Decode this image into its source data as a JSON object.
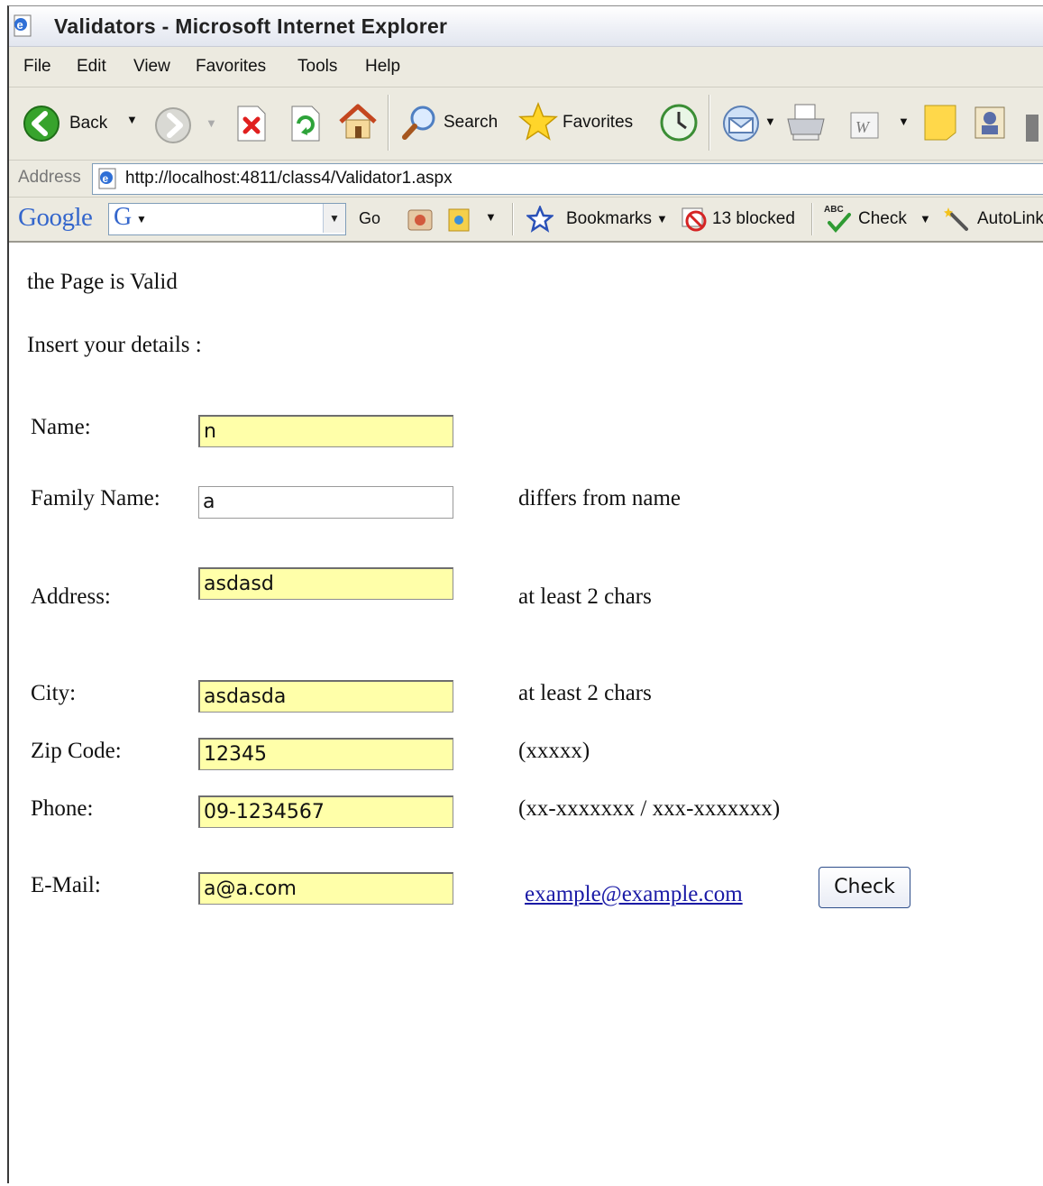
{
  "window": {
    "title": "Validators - Microsoft Internet Explorer"
  },
  "menu": [
    "File",
    "Edit",
    "View",
    "Favorites",
    "Tools",
    "Help"
  ],
  "toolbar": {
    "back_label": "Back",
    "search_label": "Search",
    "favorites_label": "Favorites"
  },
  "address": {
    "label": "Address",
    "url": "http://localhost:4811/class4/Validator1.aspx"
  },
  "googlebar": {
    "logo": "Google",
    "g_label": "G",
    "go_label": "Go",
    "bookmarks_label": "Bookmarks",
    "blocked_label": "13 blocked",
    "check_label": "Check",
    "autolink_label": "AutoLink",
    "abc_label": "ABC"
  },
  "page": {
    "status": "the Page is Valid",
    "intro": "Insert your details :",
    "fields": {
      "name": {
        "label": "Name:",
        "value": "n"
      },
      "family": {
        "label": "Family Name:",
        "value": "a",
        "hint": "differs from name"
      },
      "address": {
        "label": "Address:",
        "value": "asdasd",
        "hint": "at least 2 chars"
      },
      "city": {
        "label": "City:",
        "value": "asdasda",
        "hint": "at least 2 chars"
      },
      "zip": {
        "label": "Zip Code:",
        "value": "12345",
        "hint": "(xxxxx)"
      },
      "phone": {
        "label": "Phone:",
        "value": "09-1234567",
        "hint": "(xx-xxxxxxx / xxx-xxxxxxx)"
      },
      "email": {
        "label": "E-Mail:",
        "value": "a@a.com",
        "hint": "example@example.com"
      }
    },
    "check_button": "Check"
  }
}
